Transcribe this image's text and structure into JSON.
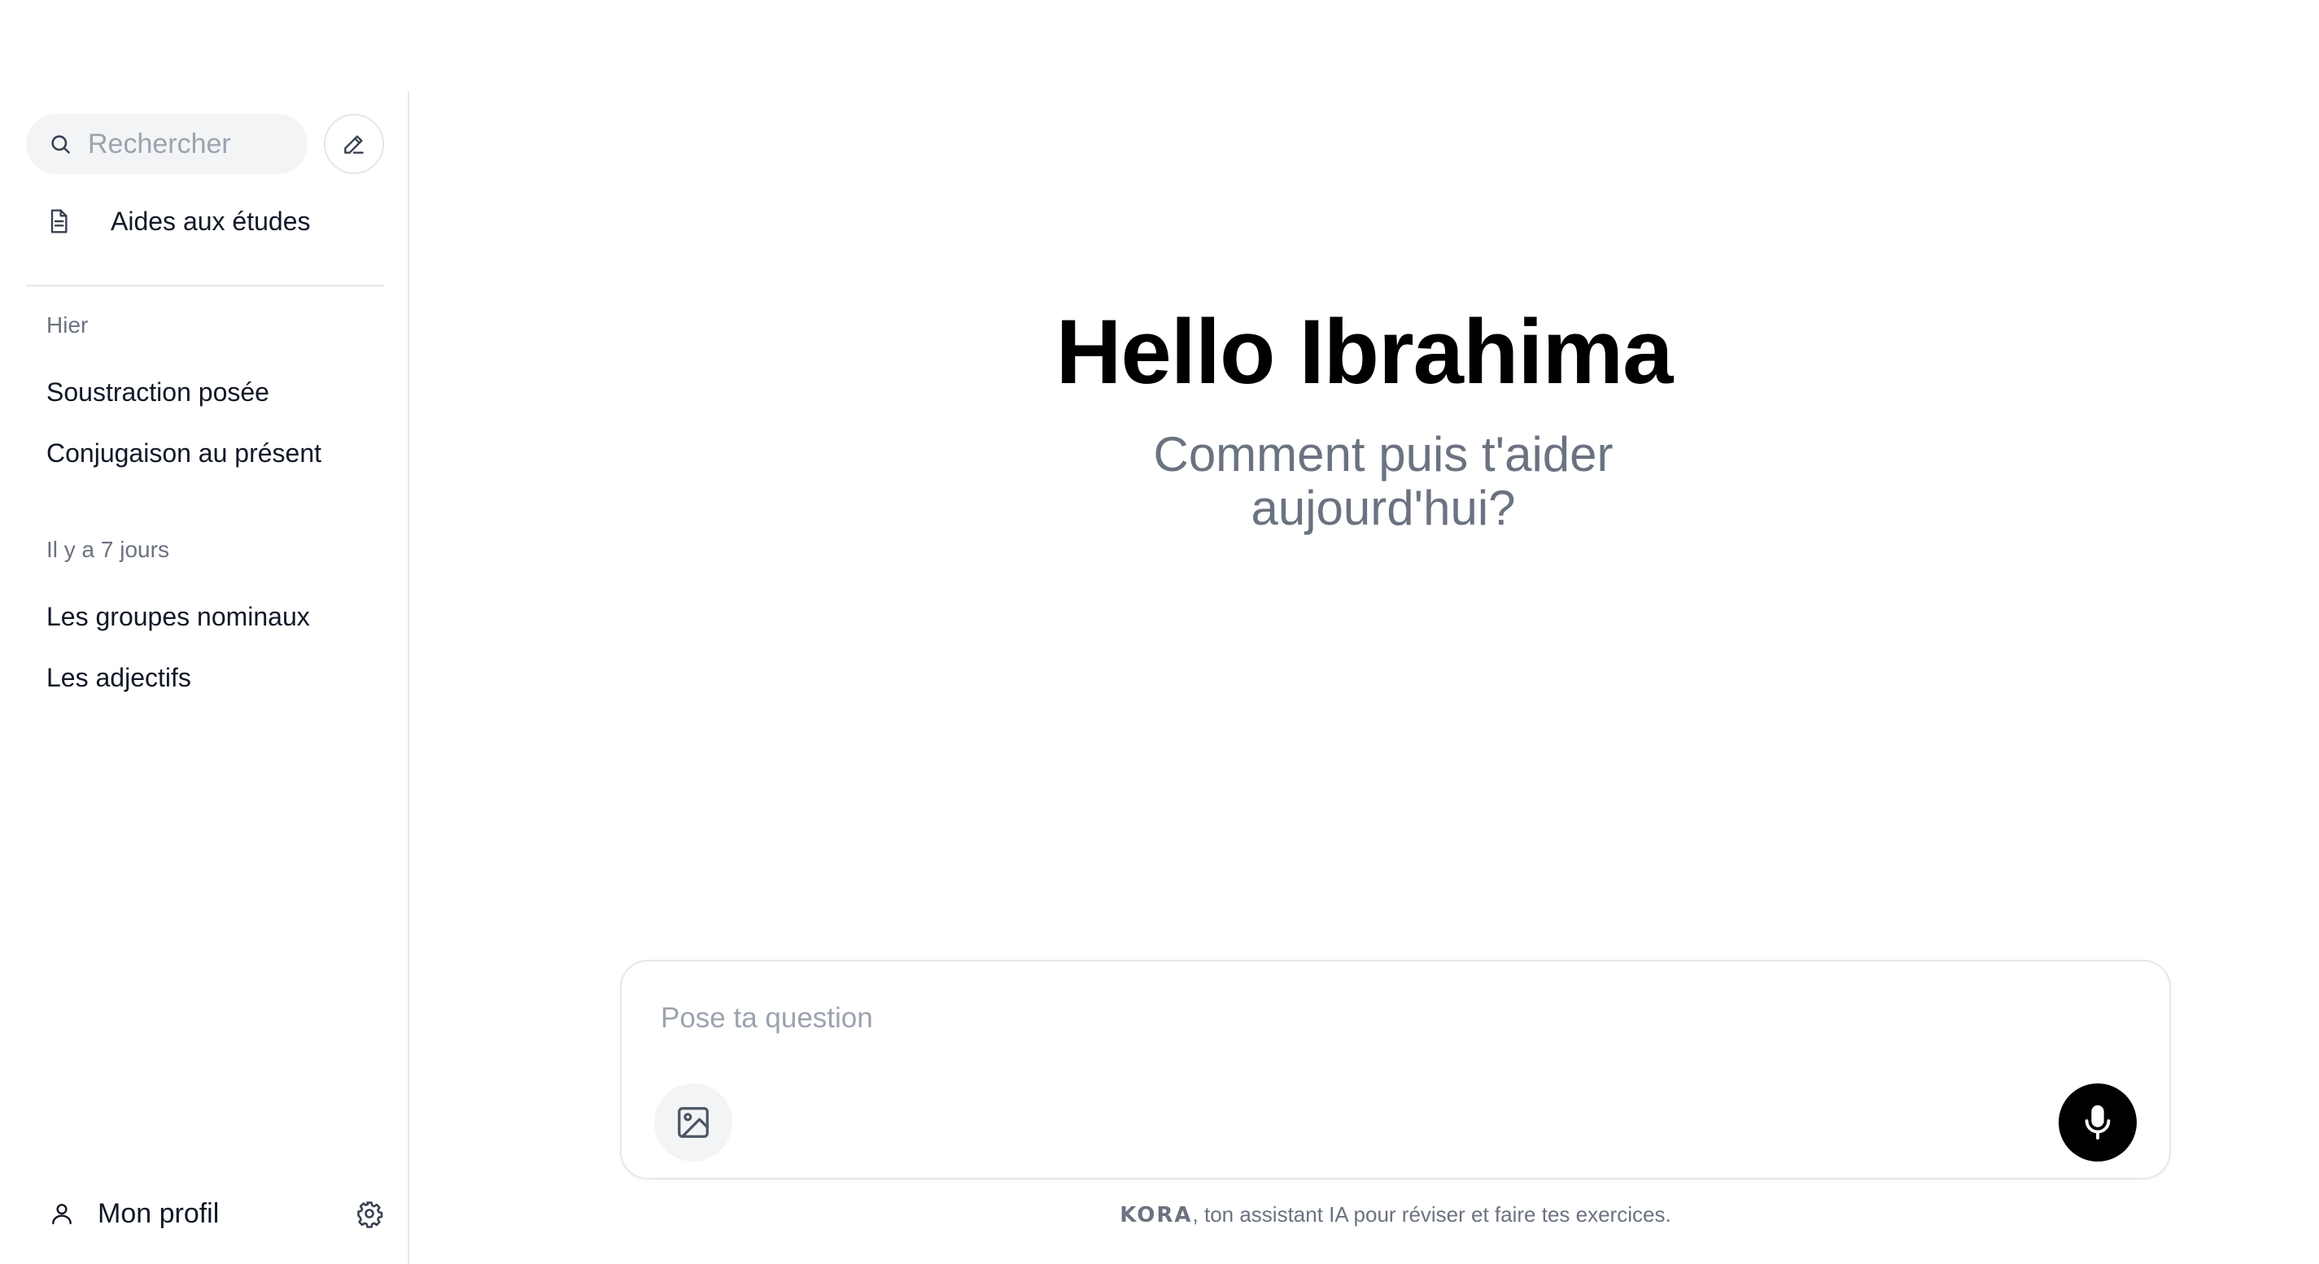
{
  "sidebar": {
    "search": {
      "placeholder": "Rechercher"
    },
    "study_aids_label": "Aides aux études",
    "groups": [
      {
        "label": "Hier",
        "items": [
          "Soustraction posée",
          "Conjugaison au présent"
        ]
      },
      {
        "label": "Il y a 7 jours",
        "items": [
          "Les groupes nominaux",
          "Les adjectifs"
        ]
      }
    ],
    "profile_label": "Mon profil"
  },
  "main": {
    "greeting": "Hello Ibrahima",
    "subtitle": "Comment puis t'aider aujourd'hui?",
    "composer": {
      "placeholder": "Pose ta question"
    },
    "footer": {
      "brand": "KORA",
      "text": ", ton assistant IA pour réviser et faire tes exercices."
    }
  },
  "icons": {
    "search": "search-icon",
    "compose": "pencil-icon",
    "study_aids": "document-icon",
    "profile": "user-icon",
    "settings": "gear-icon",
    "image": "image-icon",
    "mic": "microphone-icon"
  },
  "colors": {
    "text_primary": "#111827",
    "text_muted": "#6b7280",
    "placeholder": "#9ca3af",
    "input_bg": "#f3f4f6",
    "border": "#e5e7eb",
    "mic_button": "#000000"
  }
}
